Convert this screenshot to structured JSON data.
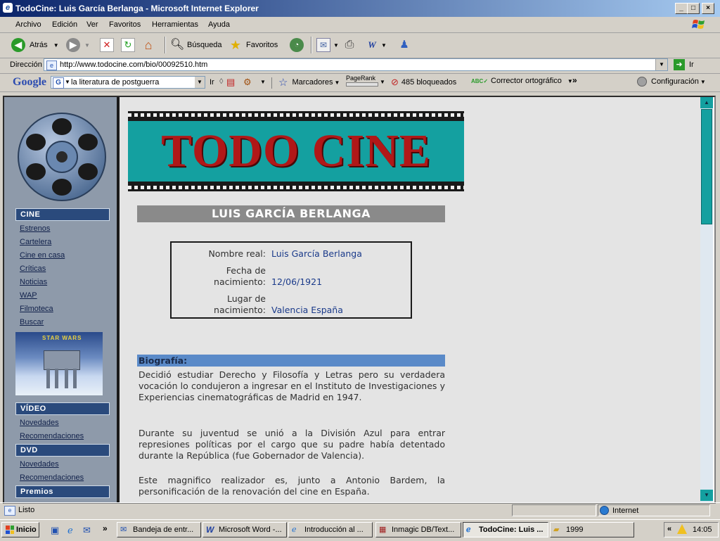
{
  "window": {
    "title": "TodoCine: Luis García Berlanga - Microsoft Internet Explorer"
  },
  "menu": [
    "Archivo",
    "Edición",
    "Ver",
    "Favoritos",
    "Herramientas",
    "Ayuda"
  ],
  "toolbar": {
    "back": "Atrás",
    "search": "Búsqueda",
    "favorites": "Favoritos"
  },
  "address": {
    "label": "Dirección",
    "url": "http://www.todocine.com/bio/00092510.htm",
    "go": "Ir"
  },
  "google": {
    "logo": "Google",
    "query": "la literatura de postguerra",
    "go": "Ir",
    "bookmarks": "Marcadores",
    "pagerank": "PageRank",
    "blocked": "485 bloqueados",
    "spell": "Corrector ortográfico",
    "settings": "Configuración"
  },
  "sidebar": {
    "cine_header": "CINE",
    "cine_links": [
      "Estrenos",
      "Cartelera",
      "Cine en casa",
      "Críticas",
      "Noticias",
      "WAP",
      "Filmoteca",
      "Buscar"
    ],
    "promo_label": "STAR WARS",
    "video_header": "VÍDEO",
    "video_links": [
      "Novedades",
      "Recomendaciones"
    ],
    "dvd_header": "DVD",
    "dvd_links": [
      "Novedades",
      "Recomendaciones"
    ],
    "premios_header": "Premios"
  },
  "page": {
    "logo": "TODO CINE",
    "person_title": "LUIS GARCÍA BERLANGA",
    "real_name_label": "Nombre real:",
    "real_name": "Luis García Berlanga",
    "birth_date_label_1": "Fecha de",
    "birth_date_label_2": "nacimiento:",
    "birth_date": "12/06/1921",
    "birth_place_label_1": "Lugar de",
    "birth_place_label_2": "nacimiento:",
    "birth_place": "Valencia España",
    "bio_header": "Biografía:",
    "bio_paragraphs": [
      "Decidió estudiar Derecho y Filosofía y Letras pero su verdadera vocación lo condujeron a ingresar en el Instituto de Investigaciones y Experiencias cinematográficas de Madrid en 1947.",
      "Durante su juventud se unió a la División Azul para entrar represiones políticas por el cargo que su padre había detentado durante la República (fue Gobernador de Valencia).",
      "Este magnifico realizador es, junto a Antonio Bardem, la personificación de la renovación del cine en España."
    ]
  },
  "status": {
    "text": "Listo",
    "zone": "Internet"
  },
  "taskbar": {
    "start": "Inicio",
    "tasks": [
      "Bandeja de entr...",
      "Microsoft Word -...",
      "Introducción al ...",
      "Inmagic DB/Text...",
      "TodoCine: Luis ...",
      "1999"
    ],
    "clock": "14:05"
  },
  "colors": {
    "teal": "#14a0a0",
    "logo_red": "#b01818",
    "nav_blue": "#2a4a7c"
  }
}
